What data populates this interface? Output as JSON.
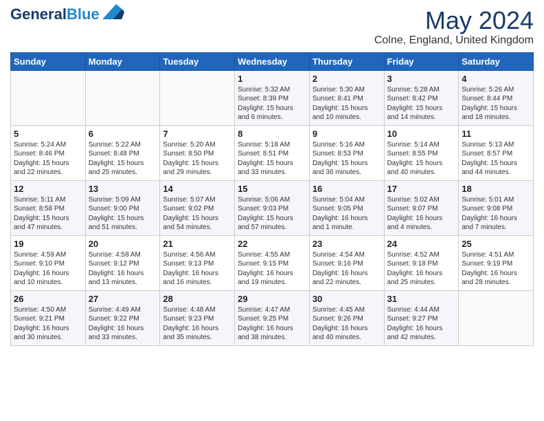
{
  "header": {
    "logo_line1": "General",
    "logo_line2": "Blue",
    "month_year": "May 2024",
    "location": "Colne, England, United Kingdom"
  },
  "days_of_week": [
    "Sunday",
    "Monday",
    "Tuesday",
    "Wednesday",
    "Thursday",
    "Friday",
    "Saturday"
  ],
  "weeks": [
    [
      {
        "day": "",
        "info": ""
      },
      {
        "day": "",
        "info": ""
      },
      {
        "day": "",
        "info": ""
      },
      {
        "day": "1",
        "info": "Sunrise: 5:32 AM\nSunset: 8:39 PM\nDaylight: 15 hours\nand 6 minutes."
      },
      {
        "day": "2",
        "info": "Sunrise: 5:30 AM\nSunset: 8:41 PM\nDaylight: 15 hours\nand 10 minutes."
      },
      {
        "day": "3",
        "info": "Sunrise: 5:28 AM\nSunset: 8:42 PM\nDaylight: 15 hours\nand 14 minutes."
      },
      {
        "day": "4",
        "info": "Sunrise: 5:26 AM\nSunset: 8:44 PM\nDaylight: 15 hours\nand 18 minutes."
      }
    ],
    [
      {
        "day": "5",
        "info": "Sunrise: 5:24 AM\nSunset: 8:46 PM\nDaylight: 15 hours\nand 22 minutes."
      },
      {
        "day": "6",
        "info": "Sunrise: 5:22 AM\nSunset: 8:48 PM\nDaylight: 15 hours\nand 25 minutes."
      },
      {
        "day": "7",
        "info": "Sunrise: 5:20 AM\nSunset: 8:50 PM\nDaylight: 15 hours\nand 29 minutes."
      },
      {
        "day": "8",
        "info": "Sunrise: 5:18 AM\nSunset: 8:51 PM\nDaylight: 15 hours\nand 33 minutes."
      },
      {
        "day": "9",
        "info": "Sunrise: 5:16 AM\nSunset: 8:53 PM\nDaylight: 15 hours\nand 36 minutes."
      },
      {
        "day": "10",
        "info": "Sunrise: 5:14 AM\nSunset: 8:55 PM\nDaylight: 15 hours\nand 40 minutes."
      },
      {
        "day": "11",
        "info": "Sunrise: 5:13 AM\nSunset: 8:57 PM\nDaylight: 15 hours\nand 44 minutes."
      }
    ],
    [
      {
        "day": "12",
        "info": "Sunrise: 5:11 AM\nSunset: 8:58 PM\nDaylight: 15 hours\nand 47 minutes."
      },
      {
        "day": "13",
        "info": "Sunrise: 5:09 AM\nSunset: 9:00 PM\nDaylight: 15 hours\nand 51 minutes."
      },
      {
        "day": "14",
        "info": "Sunrise: 5:07 AM\nSunset: 9:02 PM\nDaylight: 15 hours\nand 54 minutes."
      },
      {
        "day": "15",
        "info": "Sunrise: 5:06 AM\nSunset: 9:03 PM\nDaylight: 15 hours\nand 57 minutes."
      },
      {
        "day": "16",
        "info": "Sunrise: 5:04 AM\nSunset: 9:05 PM\nDaylight: 16 hours\nand 1 minute."
      },
      {
        "day": "17",
        "info": "Sunrise: 5:02 AM\nSunset: 9:07 PM\nDaylight: 16 hours\nand 4 minutes."
      },
      {
        "day": "18",
        "info": "Sunrise: 5:01 AM\nSunset: 9:08 PM\nDaylight: 16 hours\nand 7 minutes."
      }
    ],
    [
      {
        "day": "19",
        "info": "Sunrise: 4:59 AM\nSunset: 9:10 PM\nDaylight: 16 hours\nand 10 minutes."
      },
      {
        "day": "20",
        "info": "Sunrise: 4:58 AM\nSunset: 9:12 PM\nDaylight: 16 hours\nand 13 minutes."
      },
      {
        "day": "21",
        "info": "Sunrise: 4:56 AM\nSunset: 9:13 PM\nDaylight: 16 hours\nand 16 minutes."
      },
      {
        "day": "22",
        "info": "Sunrise: 4:55 AM\nSunset: 9:15 PM\nDaylight: 16 hours\nand 19 minutes."
      },
      {
        "day": "23",
        "info": "Sunrise: 4:54 AM\nSunset: 9:16 PM\nDaylight: 16 hours\nand 22 minutes."
      },
      {
        "day": "24",
        "info": "Sunrise: 4:52 AM\nSunset: 9:18 PM\nDaylight: 16 hours\nand 25 minutes."
      },
      {
        "day": "25",
        "info": "Sunrise: 4:51 AM\nSunset: 9:19 PM\nDaylight: 16 hours\nand 28 minutes."
      }
    ],
    [
      {
        "day": "26",
        "info": "Sunrise: 4:50 AM\nSunset: 9:21 PM\nDaylight: 16 hours\nand 30 minutes."
      },
      {
        "day": "27",
        "info": "Sunrise: 4:49 AM\nSunset: 9:22 PM\nDaylight: 16 hours\nand 33 minutes."
      },
      {
        "day": "28",
        "info": "Sunrise: 4:48 AM\nSunset: 9:23 PM\nDaylight: 16 hours\nand 35 minutes."
      },
      {
        "day": "29",
        "info": "Sunrise: 4:47 AM\nSunset: 9:25 PM\nDaylight: 16 hours\nand 38 minutes."
      },
      {
        "day": "30",
        "info": "Sunrise: 4:45 AM\nSunset: 9:26 PM\nDaylight: 16 hours\nand 40 minutes."
      },
      {
        "day": "31",
        "info": "Sunrise: 4:44 AM\nSunset: 9:27 PM\nDaylight: 16 hours\nand 42 minutes."
      },
      {
        "day": "",
        "info": ""
      }
    ]
  ]
}
